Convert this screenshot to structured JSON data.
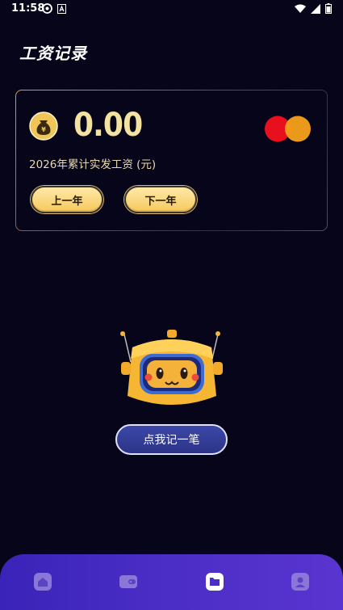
{
  "status_bar": {
    "time": "11:58"
  },
  "page": {
    "title": "工资记录"
  },
  "summary_card": {
    "amount": "0.00",
    "amount_label": "2026年累计实发工资 (元)",
    "prev_year_label": "上一年",
    "next_year_label": "下一年",
    "money_bag_symbol": "¥"
  },
  "actions": {
    "record_label": "点我记一笔"
  },
  "bottom_nav": {
    "items": [
      {
        "icon": "home-icon",
        "active": false
      },
      {
        "icon": "wallet-icon",
        "active": false
      },
      {
        "icon": "folder-icon",
        "active": true
      },
      {
        "icon": "profile-icon",
        "active": false
      }
    ]
  },
  "colors": {
    "background": "#07051a",
    "amount": "#f4e2a0",
    "button_gold": "#f6c95f",
    "nav_purple": "#4b2ec6",
    "record_button": "#3c47a8"
  }
}
